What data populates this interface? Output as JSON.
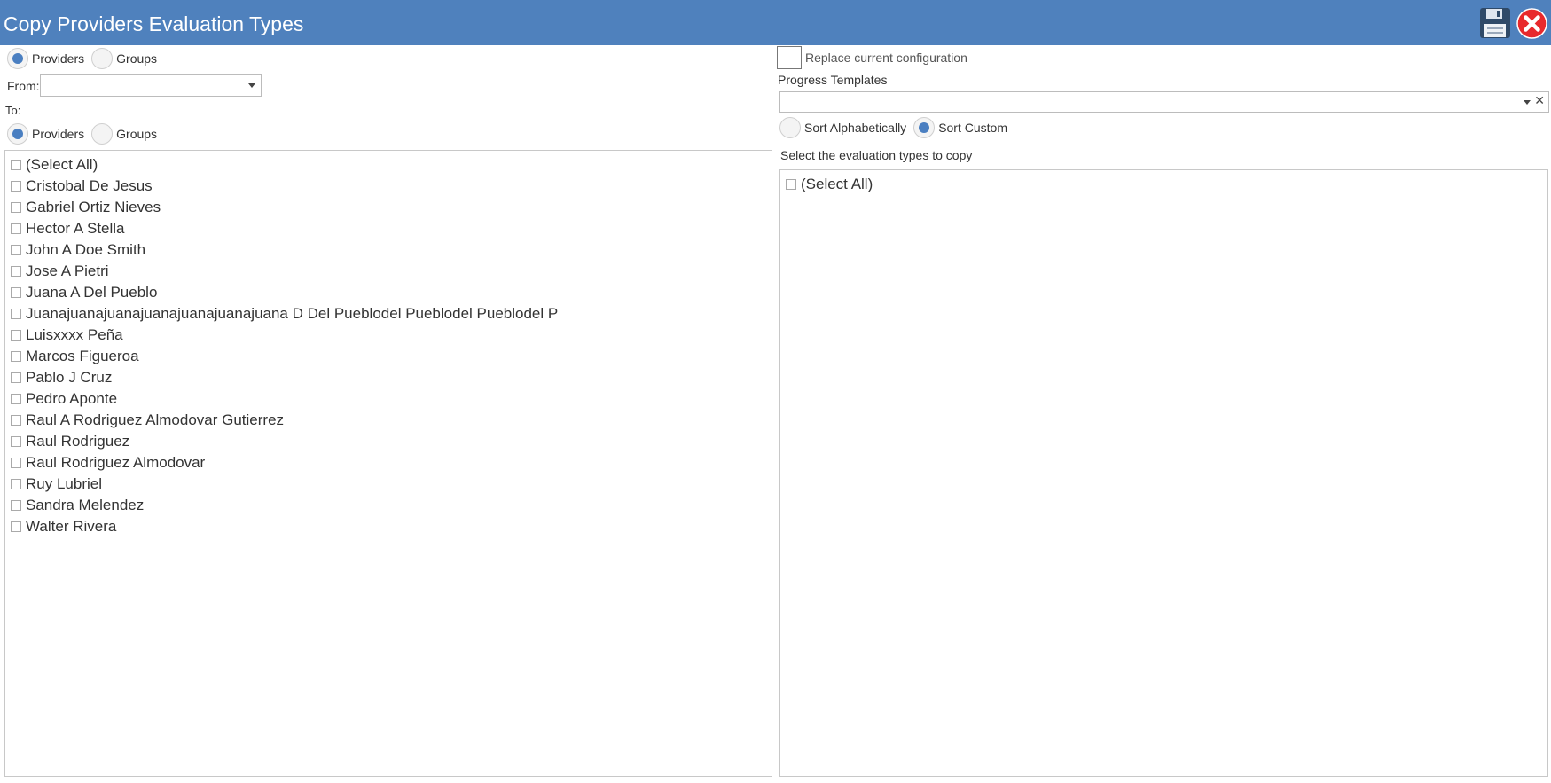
{
  "window": {
    "title": "Copy Providers Evaluation Types"
  },
  "toolbar": {
    "save_icon": "floppy-disk-icon",
    "close_icon": "close-x-icon",
    "close_color": "#e8292c"
  },
  "from_section": {
    "type_options": [
      {
        "label": "Providers",
        "selected": true
      },
      {
        "label": "Groups",
        "selected": false
      }
    ],
    "from_label": "From:",
    "from_value": ""
  },
  "to_section": {
    "to_label": "To:",
    "type_options": [
      {
        "label": "Providers",
        "selected": true
      },
      {
        "label": "Groups",
        "selected": false
      }
    ],
    "items": [
      "(Select All)",
      "Cristobal De Jesus",
      "Gabriel Ortiz Nieves",
      "Hector A Stella",
      "John A Doe Smith",
      "Jose A Pietri",
      "Juana A Del Pueblo",
      "Juanajuanajuanajuanajuanajuanajuana D Del Pueblodel Pueblodel Pueblodel P",
      "Luisxxxx Peña",
      "Marcos Figueroa",
      "Pablo J Cruz",
      "Pedro Aponte",
      "Raul A Rodriguez Almodovar Gutierrez",
      "Raul Rodriguez",
      "Raul Rodriguez Almodovar",
      "Ruy Lubriel",
      "Sandra Melendez",
      "Walter Rivera"
    ]
  },
  "right_panel": {
    "replace_label": "Replace current configuration",
    "replace_checked": false,
    "templates_label": "Progress Templates",
    "templates_value": "",
    "sort_options": [
      {
        "label": "Sort Alphabetically",
        "selected": false
      },
      {
        "label": "Sort Custom",
        "selected": true
      }
    ],
    "eval_label": "Select the evaluation types to copy",
    "eval_items": [
      "(Select All)"
    ]
  },
  "colors": {
    "titlebar": "#4f81bd",
    "radio_dot": "#4a7fc1"
  }
}
